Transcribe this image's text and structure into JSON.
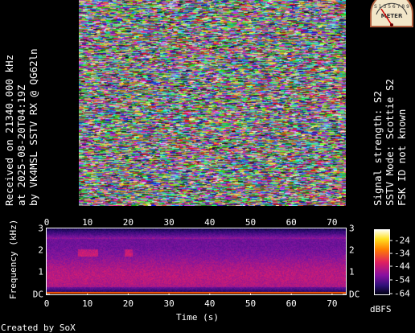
{
  "left_caption": {
    "line1": "Received on  21340.000 kHz",
    "line2": "at 2025-08-20T04:19Z",
    "line3": "by VK4MSL SSTV RX @ QG62ln"
  },
  "right_caption": {
    "line1": "Signal strength: S2",
    "line2": "SSTV Mode: Scottie S2",
    "line3": "FSK ID not known"
  },
  "meter": {
    "label": "METER",
    "scale_text": "S 1 3 5 6 7 8 9"
  },
  "spectrogram": {
    "x_ticks": [
      "0",
      "10",
      "20",
      "30",
      "40",
      "50",
      "60",
      "70"
    ],
    "y_ticks_left": [
      "3",
      "2",
      "1",
      "DC"
    ],
    "y_ticks_right": [
      "3",
      "2",
      "1",
      "DC"
    ],
    "xlabel": "Time (s)",
    "ylabel": "Frequency (kHz)"
  },
  "colorbar": {
    "ticks": [
      "-24",
      "-34",
      "-44",
      "-54",
      "-64"
    ],
    "unit": "dBFS"
  },
  "footer": "Created by SoX"
}
